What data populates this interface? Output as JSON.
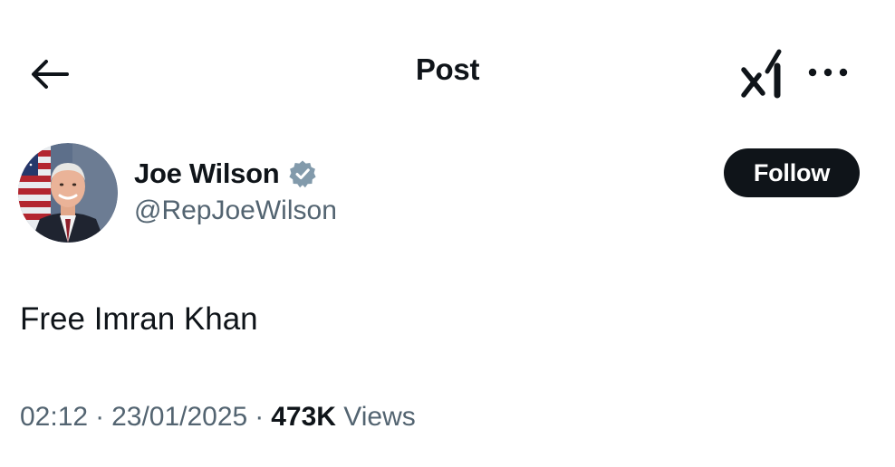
{
  "header": {
    "title": "Post",
    "back_icon": "arrow-left-icon",
    "grok_icon": "grok-icon",
    "more_icon": "more-horizontal-icon"
  },
  "author": {
    "display_name": "Joe Wilson",
    "handle": "@RepJoeWilson",
    "verified_icon": "verified-badge-icon",
    "verified_color": "#829aab",
    "follow_label": "Follow"
  },
  "post": {
    "text": "Free Imran Khan",
    "time": "02:12",
    "date": "23/01/2025",
    "separator": "·",
    "views_count": "473K",
    "views_label": "Views"
  },
  "colors": {
    "text_primary": "#0f1419",
    "text_secondary": "#536471",
    "button_bg": "#0f1419",
    "button_text": "#ffffff",
    "background": "#ffffff"
  }
}
